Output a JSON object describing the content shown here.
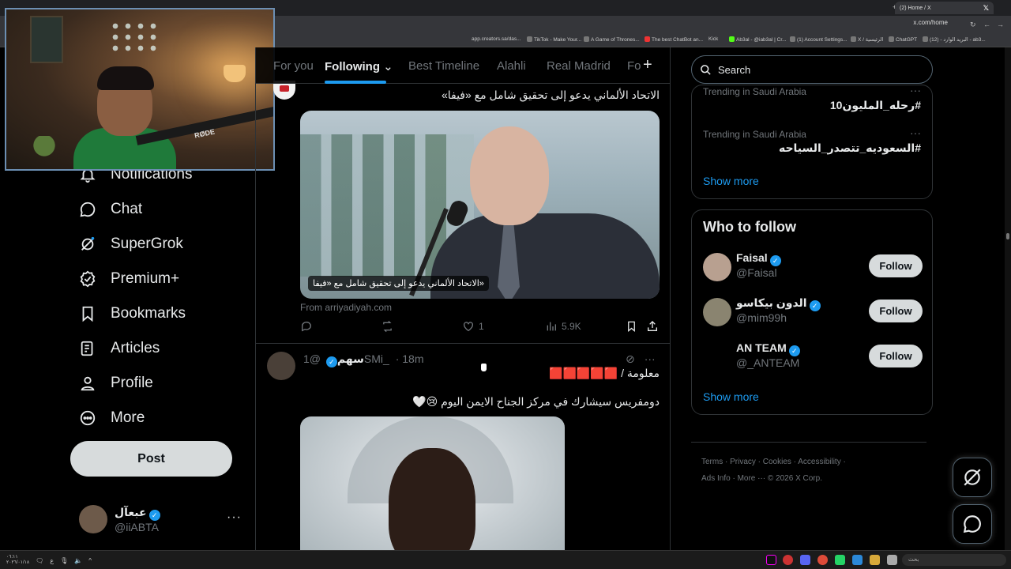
{
  "browser": {
    "tab_title": "(2) Home / X",
    "url": "x.com/home",
    "bookmarks": [
      "app.creators.sa/das...",
      "TikTok - Make Your...",
      "A Game of Thrones...",
      "The best ChatBot an...",
      "Kick",
      "Ab3al - @iab3al | Cr...",
      "(1) Account Settings...",
      "X / الرئيسية",
      "ChatGPT",
      "(12) - البريد الوارد - ab3..."
    ]
  },
  "sidebar": {
    "items": [
      {
        "label": "Notifications",
        "icon": "bell-icon"
      },
      {
        "label": "Chat",
        "icon": "chat-bubble-icon"
      },
      {
        "label": "SuperGrok",
        "icon": "grok-icon"
      },
      {
        "label": "Premium+",
        "icon": "verified-badge-icon"
      },
      {
        "label": "Bookmarks",
        "icon": "bookmark-icon"
      },
      {
        "label": "Articles",
        "icon": "article-icon"
      },
      {
        "label": "Profile",
        "icon": "person-icon"
      },
      {
        "label": "More",
        "icon": "more-circle-icon"
      }
    ],
    "post_label": "Post",
    "account": {
      "name": "عبعآل",
      "handle": "@iiABTA",
      "more": "···"
    }
  },
  "feed": {
    "tabs": [
      "For you",
      "Following",
      "Best Timeline",
      "Alahli",
      "Real Madrid",
      "Fo"
    ],
    "active_tab": "Following",
    "tweet1": {
      "text": "الاتحاد الألماني يدعو إلى تحقيق شامل مع «فيفا»",
      "caption": "«الاتحاد الألماني يدعو إلى تحقيق شامل مع «فيفا",
      "source": "From arriyadiyah.com",
      "likes": "1",
      "views": "5.9K"
    },
    "tweet2": {
      "name": "سهم",
      "handle": "@1SMi_",
      "time": "· 18m",
      "line1": "معلومة / 🟥🟥🟥🟥🟥",
      "line2": "دومفريس سيشارك في مركز الجناح الايمن اليوم 😢🤍"
    }
  },
  "right": {
    "search_placeholder": "Search",
    "trends": [
      {
        "context": "Trending in Saudi Arabia",
        "tag": "#رحله_المليون10"
      },
      {
        "context": "Trending in Saudi Arabia",
        "tag": "#السعوديه_تتصدر_السياحه"
      }
    ],
    "show_more": "Show more",
    "who_to_follow": {
      "title": "Who to follow",
      "users": [
        {
          "name": "Faisal",
          "handle": "@Faisal"
        },
        {
          "name": "الدون بيكاسو",
          "handle": "@mim99h"
        },
        {
          "name": "AN TEAM",
          "handle": "@_ANTEAM"
        }
      ],
      "follow_label": "Follow",
      "show_more": "Show more"
    },
    "footer_line1": "Terms  ·  Privacy  ·  Cookies  ·  Accessibility  ·",
    "footer_line2": "Ads Info  ·  More ···  © 2026 X Corp."
  },
  "taskbar": {
    "search_placeholder": "بحث",
    "time": "٠٦:١١",
    "date": "٢٠٢٦/٠١/١٨"
  },
  "colors": {
    "accent": "#1d9bf0",
    "background": "#000000",
    "border": "#2f3336",
    "muted": "#71767b"
  }
}
